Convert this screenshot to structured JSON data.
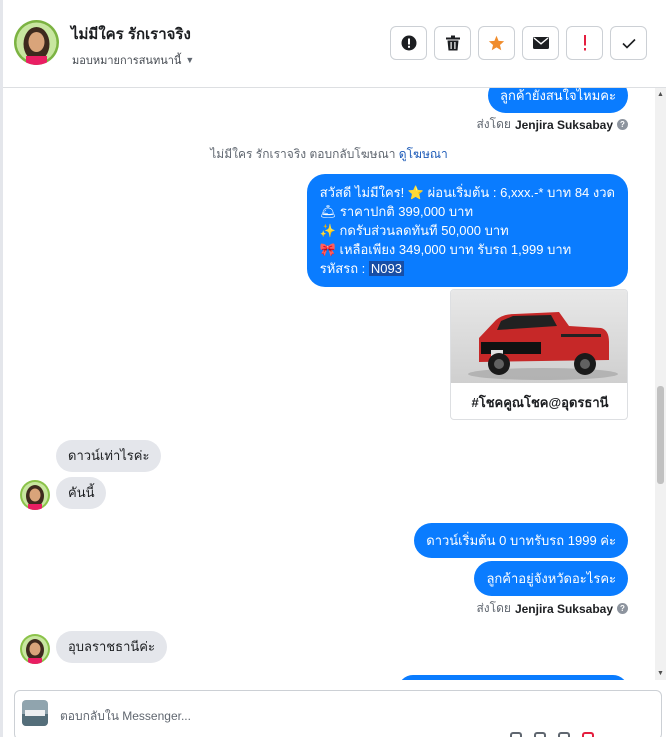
{
  "header": {
    "contact_name": "ไม่มีใคร รักเราจริง",
    "assign_label": "มอบหมายการสนทนานี้",
    "actions": [
      {
        "name": "mark-spam",
        "icon": "alert-circle-icon"
      },
      {
        "name": "delete",
        "icon": "trash-icon"
      },
      {
        "name": "star",
        "icon": "star-icon",
        "color": "#f08c2c"
      },
      {
        "name": "mark-unread",
        "icon": "envelope-icon"
      },
      {
        "name": "follow-up",
        "icon": "exclamation-icon",
        "color": "#e41e3f"
      },
      {
        "name": "mark-done",
        "icon": "check-icon"
      }
    ]
  },
  "chat": {
    "msg_top": "ลูกค้ายังสนใจไหมคะ",
    "sent_by_prefix": "ส่งโดย",
    "agent_name": "Jenjira Suksabay",
    "system_line_text": "ไม่มีใคร รักเราจริง ตอบกลับโฆษณา",
    "system_line_link": "ดูโฆษณา",
    "promo": {
      "line1": "สวัสดี ไม่มีใคร! ⭐ ผ่อนเริ่มต้น : 6,xxx.-* บาท 84 งวด",
      "line2": "🛎 ราคาปกติ  399,000 บาท",
      "line3": "✨ กดรับส่วนลดทันที 50,000 บาท",
      "line4": "🎀 เหลือเพียง 349,000 บาท รับรถ 1,999 บาท",
      "line5_label": "รหัสรถ : ",
      "line5_code": "N093"
    },
    "card_text": "#โชคคูณโชค@อุดรธานี",
    "msg_in_1": "ดาวน์เท่าไรค่ะ",
    "msg_in_2": "คันนี้",
    "msg_out_1": "ดาวน์เริ่มต้น 0 บาทรับรถ 1999 ค่ะ",
    "msg_out_2": "ลูกค้าอยู่จังหวัดอะไรคะ",
    "msg_in_3": "อุบลราชธานีค่ะ"
  },
  "composer": {
    "placeholder": "ตอบกลับใน Messenger..."
  },
  "colors": {
    "outgoing_bubble": "#0a7cff",
    "incoming_bubble": "#e4e6eb",
    "link": "#1d5bb8"
  }
}
